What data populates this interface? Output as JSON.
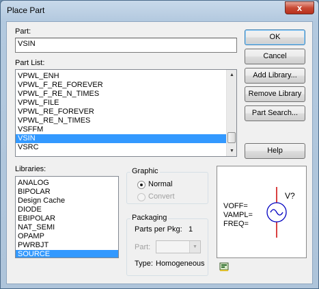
{
  "window": {
    "title": "Place Part",
    "close_label": "x"
  },
  "part": {
    "label": "Part:",
    "value": "VSIN"
  },
  "part_list": {
    "label": "Part List:",
    "items": [
      "VPWL_ENH",
      "VPWL_F_RE_FOREVER",
      "VPWL_F_RE_N_TIMES",
      "VPWL_FILE",
      "VPWL_RE_FOREVER",
      "VPWL_RE_N_TIMES",
      "VSFFM",
      "VSIN",
      "VSRC"
    ],
    "selected": "VSIN"
  },
  "libraries": {
    "label": "Libraries:",
    "items": [
      "ANALOG",
      "BIPOLAR",
      "Design Cache",
      "DIODE",
      "EBIPOLAR",
      "NAT_SEMI",
      "OPAMP",
      "PWRBJT",
      "SOURCE"
    ],
    "selected": "SOURCE"
  },
  "buttons": {
    "ok": "OK",
    "cancel": "Cancel",
    "add_library": "Add Library...",
    "remove_library": "Remove Library",
    "part_search": "Part Search...",
    "help": "Help"
  },
  "graphic": {
    "title": "Graphic",
    "normal": "Normal",
    "convert": "Convert",
    "selected": "Normal"
  },
  "packaging": {
    "title": "Packaging",
    "parts_per_pkg_label": "Parts per Pkg:",
    "parts_per_pkg_value": "1",
    "part_label": "Part:",
    "type_label": "Type:",
    "type_value": "Homogeneous"
  },
  "preview": {
    "ref": "V?",
    "attrs": [
      "VOFF=",
      "VAMPL=",
      "FREQ="
    ]
  },
  "colors": {
    "selection": "#3399ff",
    "symbol": "#0000c0",
    "pin": "#cc0000"
  }
}
